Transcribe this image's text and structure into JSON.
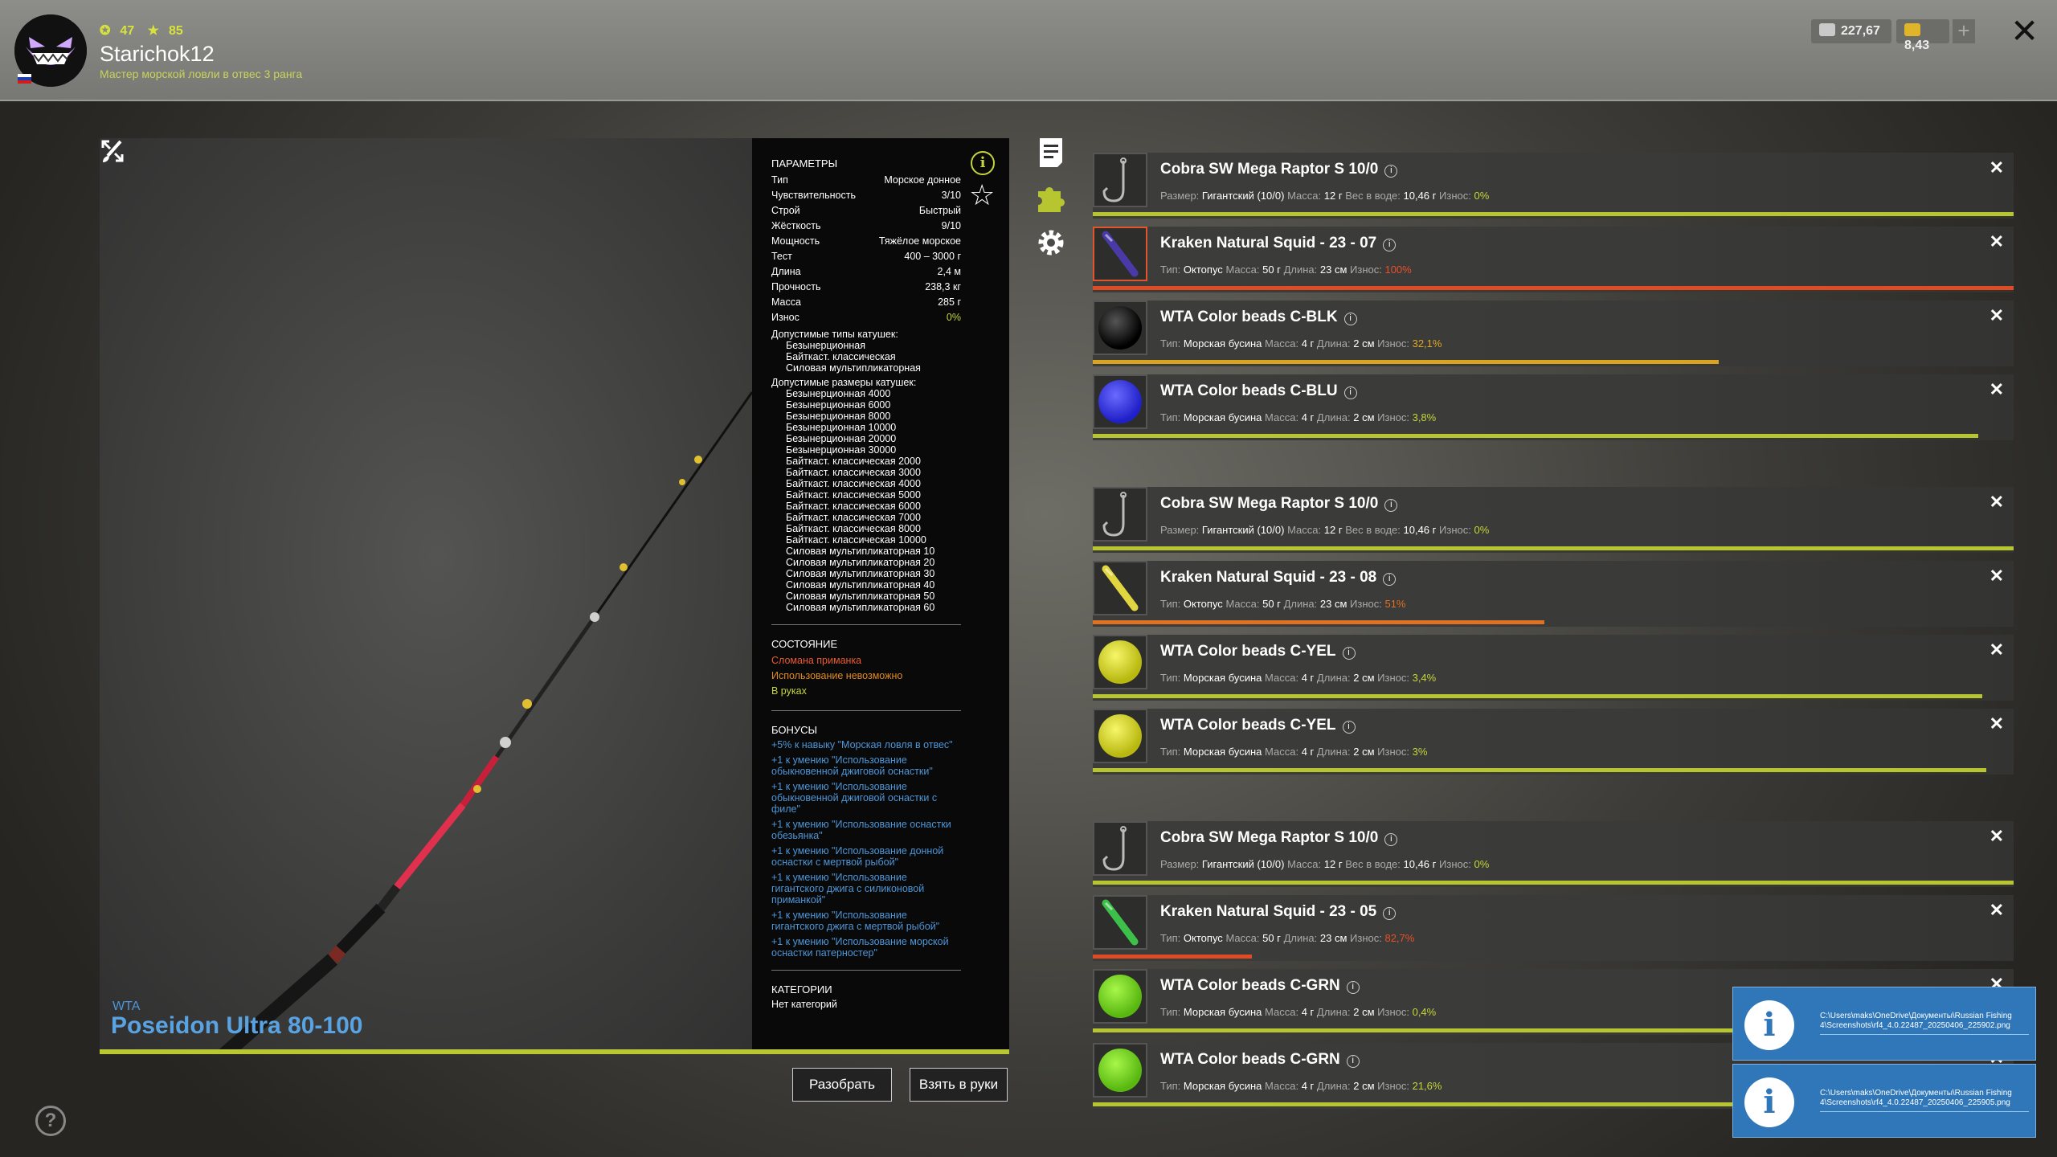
{
  "header": {
    "level": "47",
    "stars": "85",
    "username": "Starichok12",
    "rank": "Мастер морской ловли в отвес 3 ранга",
    "silver": "227,67",
    "gold": "8,43",
    "plus": "+",
    "close": "✕"
  },
  "rod": {
    "brand": "WTA",
    "name": "Poseidon Ultra 80-100"
  },
  "params": {
    "title": "ПАРАМЕТРЫ",
    "rows": [
      {
        "label": "Тип",
        "value": "Морское донное"
      },
      {
        "label": "Чувствительность",
        "value": "3/10"
      },
      {
        "label": "Строй",
        "value": "Быстрый"
      },
      {
        "label": "Жёсткость",
        "value": "9/10"
      },
      {
        "label": "Мощность",
        "value": "Тяжёлое морское"
      },
      {
        "label": "Тест",
        "value": "400 – 3000 г"
      },
      {
        "label": "Длина",
        "value": "2,4 м"
      },
      {
        "label": "Прочность",
        "value": "238,3 кг"
      },
      {
        "label": "Масса",
        "value": "285 г"
      },
      {
        "label": "Износ",
        "value": "0%"
      }
    ],
    "reel_types_title": "Допустимые типы катушек:",
    "reel_types": [
      "Безынерционная",
      "Байткаст. классическая",
      "Силовая мультипликаторная"
    ],
    "reel_sizes_title": "Допустимые размеры катушек:",
    "reel_sizes": [
      "Безынерционная 4000",
      "Безынерционная 6000",
      "Безынерционная 8000",
      "Безынерционная 10000",
      "Безынерционная 20000",
      "Безынерционная 30000",
      "Байткаст. классическая 2000",
      "Байткаст. классическая 3000",
      "Байткаст. классическая 4000",
      "Байткаст. классическая 5000",
      "Байткаст. классическая 6000",
      "Байткаст. классическая 7000",
      "Байткаст. классическая 8000",
      "Байткаст. классическая 10000",
      "Силовая мультипликаторная 10",
      "Силовая мультипликаторная 20",
      "Силовая мультипликаторная 30",
      "Силовая мультипликаторная 40",
      "Силовая мультипликаторная 50",
      "Силовая мультипликаторная 60"
    ],
    "state_title": "СОСТОЯНИЕ",
    "state_broken": "Сломана приманка",
    "state_unusable": "Использование невозможно",
    "state_in_hands": "В руках",
    "bonus_title": "БОНУСЫ",
    "bonuses": [
      "+5% к навыку \"Морская ловля в отвес\"",
      "+1 к умению \"Использование обыкновенной джиговой оснастки\"",
      "+1 к умению \"Использование обыкновенной джиговой оснастки с филе\"",
      "+1 к умению \"Использование оснастки обезьянка\"",
      "+1 к умению \"Использование донной оснастки с мертвой рыбой\"",
      "+1 к умению \"Использование гигантского джига с силиконовой приманкой\"",
      "+1 к умению \"Использование гигантского джига с мертвой рыбой\"",
      "+1 к умению \"Использование морской оснастки патерностер\""
    ],
    "categories_title": "КАТЕГОРИИ",
    "categories": "Нет категорий",
    "info": "i",
    "star": "☆"
  },
  "buttons": {
    "disassemble": "Разобрать",
    "take": "Взять в руки"
  },
  "items": [
    {
      "name": "Cobra SW Mega Raptor S 10/0",
      "icon": "hook-icon",
      "l1": "Размер:",
      "v1": "Гигантский (10/0)",
      "l2": "Масса:",
      "v2": "12 г",
      "l3": "Вес в воде:",
      "v3": "10,46 г",
      "wear_label": "Износ:",
      "wear": "0%",
      "wear_fraction": 1.0,
      "wear_color": "#b7c630",
      "wear_text_color": "#c5d53a"
    },
    {
      "name": "Kraken Natural Squid - 23 - 07",
      "icon": "squid-icon-purple",
      "l1": "Тип:",
      "v1": "Октопус",
      "l2": "Масса:",
      "v2": "50 г",
      "l3": "Длина:",
      "v3": "23 см",
      "wear_label": "Износ:",
      "wear": "100%",
      "wear_fraction": 1.0,
      "wear_color": "#e04a24",
      "wear_text_color": "#e8502a"
    },
    {
      "name": "WTA Color beads C-BLK",
      "icon": "bead-black",
      "l1": "Тип:",
      "v1": "Морская бусина",
      "l2": "Масса:",
      "v2": "4 г",
      "l3": "Длина:",
      "v3": "2 см",
      "wear_label": "Износ:",
      "wear": "32,1%",
      "wear_fraction": 0.68,
      "wear_color": "#d9a520",
      "wear_text_color": "#e0a824"
    },
    {
      "name": "WTA Color beads C-BLU",
      "icon": "bead-blue",
      "l1": "Тип:",
      "v1": "Морская бусина",
      "l2": "Масса:",
      "v2": "4 г",
      "l3": "Длина:",
      "v3": "2 см",
      "wear_label": "Износ:",
      "wear": "3,8%",
      "wear_fraction": 0.962,
      "wear_color": "#b7c630",
      "wear_text_color": "#c5d53a"
    },
    {
      "name": "Cobra SW Mega Raptor S 10/0",
      "icon": "hook-icon",
      "l1": "Размер:",
      "v1": "Гигантский (10/0)",
      "l2": "Масса:",
      "v2": "12 г",
      "l3": "Вес в воде:",
      "v3": "10,46 г",
      "wear_label": "Износ:",
      "wear": "0%",
      "wear_fraction": 1.0,
      "wear_color": "#b7c630",
      "wear_text_color": "#c5d53a"
    },
    {
      "name": "Kraken Natural Squid - 23 - 08",
      "icon": "squid-icon-yellow",
      "l1": "Тип:",
      "v1": "Октопус",
      "l2": "Масса:",
      "v2": "50 г",
      "l3": "Длина:",
      "v3": "23 см",
      "wear_label": "Износ:",
      "wear": "51%",
      "wear_fraction": 0.49,
      "wear_color": "#e07024",
      "wear_text_color": "#e07024"
    },
    {
      "name": "WTA Color beads C-YEL",
      "icon": "bead-yellow",
      "l1": "Тип:",
      "v1": "Морская бусина",
      "l2": "Масса:",
      "v2": "4 г",
      "l3": "Длина:",
      "v3": "2 см",
      "wear_label": "Износ:",
      "wear": "3,4%",
      "wear_fraction": 0.966,
      "wear_color": "#b7c630",
      "wear_text_color": "#c5d53a"
    },
    {
      "name": "WTA Color beads C-YEL",
      "icon": "bead-yellow",
      "l1": "Тип:",
      "v1": "Морская бусина",
      "l2": "Масса:",
      "v2": "4 г",
      "l3": "Длина:",
      "v3": "2 см",
      "wear_label": "Износ:",
      "wear": "3%",
      "wear_fraction": 0.97,
      "wear_color": "#b7c630",
      "wear_text_color": "#c5d53a"
    },
    {
      "name": "Cobra SW Mega Raptor S 10/0",
      "icon": "hook-icon",
      "l1": "Размер:",
      "v1": "Гигантский (10/0)",
      "l2": "Масса:",
      "v2": "12 г",
      "l3": "Вес в воде:",
      "v3": "10,46 г",
      "wear_label": "Износ:",
      "wear": "0%",
      "wear_fraction": 1.0,
      "wear_color": "#b7c630",
      "wear_text_color": "#c5d53a"
    },
    {
      "name": "Kraken Natural Squid - 23 - 05",
      "icon": "squid-icon-green",
      "l1": "Тип:",
      "v1": "Октопус",
      "l2": "Масса:",
      "v2": "50 г",
      "l3": "Длина:",
      "v3": "23 см",
      "wear_label": "Износ:",
      "wear": "82,7%",
      "wear_fraction": 0.173,
      "wear_color": "#e04a24",
      "wear_text_color": "#e8502a"
    },
    {
      "name": "WTA Color beads C-GRN",
      "icon": "bead-green",
      "l1": "Тип:",
      "v1": "Морская бусина",
      "l2": "Масса:",
      "v2": "4 г",
      "l3": "Длина:",
      "v3": "2 см",
      "wear_label": "Износ:",
      "wear": "0,4%",
      "wear_fraction": 0.996,
      "wear_color": "#b7c630",
      "wear_text_color": "#c5d53a"
    },
    {
      "name": "WTA Color beads C-GRN",
      "icon": "bead-green",
      "l1": "Тип:",
      "v1": "Морская бусина",
      "l2": "Масса:",
      "v2": "4 г",
      "l3": "Длина:",
      "v3": "2 см",
      "wear_label": "Износ:",
      "wear": "21,6%",
      "wear_fraction": 0.784,
      "wear_color": "#b7c630",
      "wear_text_color": "#c5d53a"
    }
  ],
  "toasts": [
    "C:\\Users\\maks\\OneDrive\\Документы\\Russian Fishing 4\\Screenshots\\rf4_4.0.22487_20250406_225902.png",
    "C:\\Users\\maks\\OneDrive\\Документы\\Russian Fishing 4\\Screenshots\\rf4_4.0.22487_20250406_225905.png"
  ],
  "help": "?"
}
